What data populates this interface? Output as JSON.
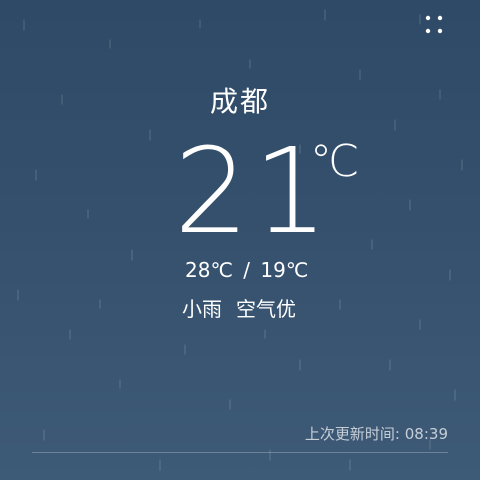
{
  "weather": {
    "city": "成都",
    "temperature": "21",
    "temperature_unit": "℃",
    "high": "28℃",
    "range_separator": "/",
    "low": "19℃",
    "condition": "小雨",
    "air_quality": "空气优",
    "updated_label": "上次更新时间:",
    "updated_time": "08:39"
  },
  "icons": {
    "menu": "four-dots-icon",
    "background": "rain-effect"
  },
  "colors": {
    "bg_top": "#2e4a66",
    "bg_bottom": "#3d5a77",
    "text": "#ffffff"
  }
}
